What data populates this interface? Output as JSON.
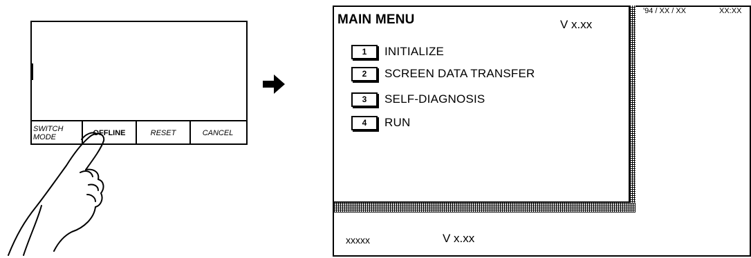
{
  "panel": {
    "function_keys": [
      {
        "label": "SWITCH MODE"
      },
      {
        "label": "OFFLINE"
      },
      {
        "label": "RESET"
      },
      {
        "label": "CANCEL"
      }
    ]
  },
  "main_menu": {
    "title": "MAIN MENU",
    "version": "V x.xx",
    "date": "'94 / XX / XX",
    "time": "XX:XX",
    "items": [
      {
        "key": "1",
        "label": "INITIALIZE"
      },
      {
        "key": "2",
        "label": "SCREEN DATA TRANSFER"
      },
      {
        "key": "3",
        "label": "SELF-DIAGNOSIS"
      },
      {
        "key": "4",
        "label": "RUN"
      }
    ],
    "footer": {
      "model": "xxxxx",
      "version": "V x.xx"
    }
  },
  "icons": [
    "hand-pointer-icon",
    "right-arrow-icon"
  ]
}
